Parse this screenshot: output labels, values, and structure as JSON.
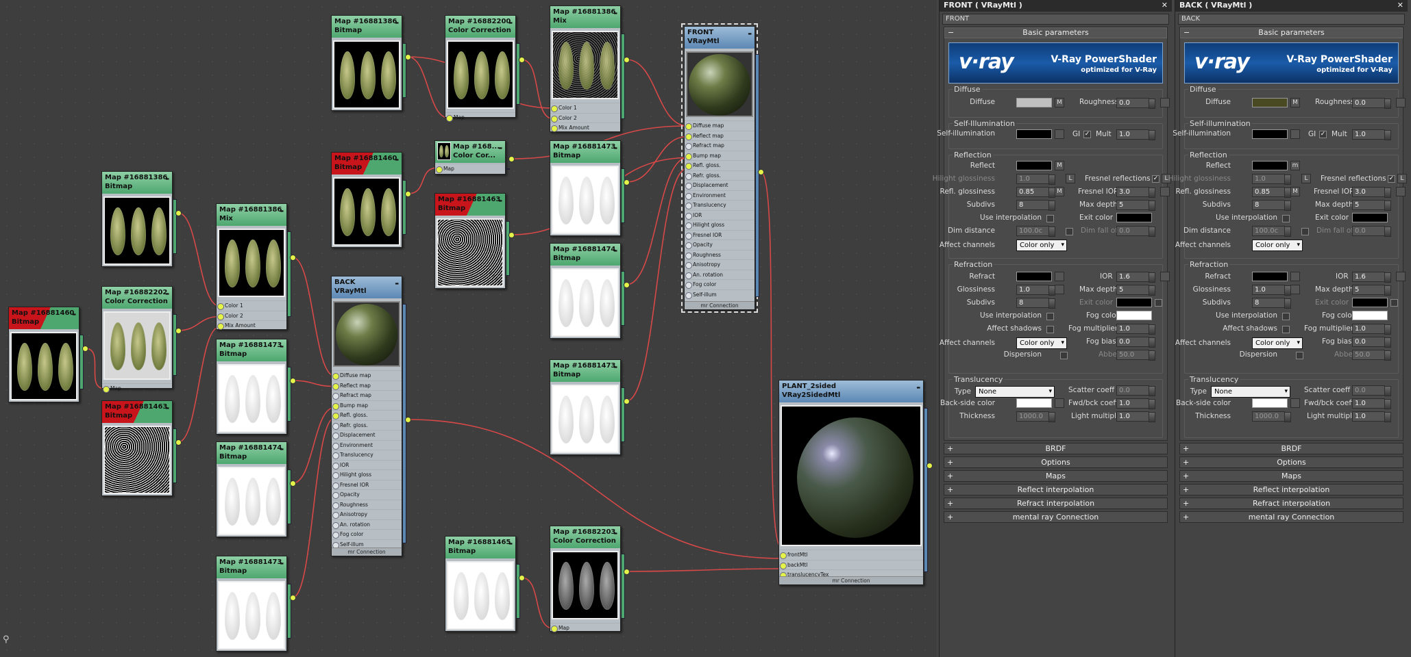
{
  "nodes": {
    "n1": {
      "id": "Map #16881460",
      "type": "Bitmap"
    },
    "n2": {
      "id": "Map #16881386",
      "type": "Bitmap"
    },
    "n3": {
      "id": "Map #16882202",
      "type": "Color Correction",
      "slots": [
        "Map"
      ]
    },
    "n4": {
      "id": "Map #16881463",
      "type": "Bitmap"
    },
    "n5": {
      "id": "Map #16881386",
      "type": "Mix",
      "slots": [
        "Color 1",
        "Color 2",
        "Mix Amount"
      ]
    },
    "n6": {
      "id": "Map #16881473",
      "type": "Bitmap"
    },
    "n7": {
      "id": "Map #16881474",
      "type": "Bitmap"
    },
    "n8": {
      "id": "Map #16881473",
      "type": "Bitmap"
    },
    "n9": {
      "id": "Map #16881386",
      "type": "Bitmap"
    },
    "n10": {
      "id": "Map #16881460",
      "type": "Bitmap"
    },
    "n11": {
      "id": "BACK",
      "type": "VRayMtl"
    },
    "n12": {
      "id": "Map #16882200",
      "type": "Color Correction",
      "slots": [
        "Map"
      ]
    },
    "n13": {
      "id": "Map #168...",
      "type": "Color Cor...",
      "slots": [
        "Map"
      ]
    },
    "n14": {
      "id": "Map #16881463",
      "type": "Bitmap"
    },
    "n15": {
      "id": "Map #16881465",
      "type": "Bitmap"
    },
    "n16": {
      "id": "Map #16881386",
      "type": "Mix",
      "slots": [
        "Color 1",
        "Color 2",
        "Mix Amount"
      ]
    },
    "n17": {
      "id": "Map #16881473",
      "type": "Bitmap"
    },
    "n18": {
      "id": "Map #16881474",
      "type": "Bitmap"
    },
    "n19": {
      "id": "Map #16881473",
      "type": "Bitmap"
    },
    "n20": {
      "id": "Map #16882203",
      "type": "Color Correction",
      "slots": [
        "Map"
      ]
    },
    "n21": {
      "id": "FRONT",
      "type": "VRayMtl"
    },
    "n22": {
      "id": "PLANT_2sided",
      "type": "VRay2SidedMtl",
      "slots": [
        "frontMtl",
        "backMtl",
        "translucencyTex"
      ]
    }
  },
  "vray_slots": [
    "Diffuse map",
    "Reflect map",
    "Refract map",
    "Bump map",
    "Refl. gloss.",
    "Refr. gloss.",
    "Displacement",
    "Environment",
    "Translucency",
    "IOR",
    "Hilight gloss",
    "Fresnel IOR",
    "Opacity",
    "Roughness",
    "Anisotropy",
    "An. rotation",
    "Fog color",
    "Self-illum"
  ],
  "mr_connection": "mr Connection",
  "mr_connection2": "mr Connection",
  "panels": [
    {
      "title": "FRONT  ( VRayMtl )",
      "name": "FRONT",
      "diffuse_color": "#c0c0c0",
      "basic": "Basic parameters",
      "logo_brand": "v·ray",
      "logo_title": "V-Ray PowerShader",
      "logo_sub": "optimized for V-Ray",
      "diffuse_grp": "Diffuse",
      "diffuse": "Diffuse",
      "m": "M",
      "roughness": "Roughness",
      "roughness_val": "0.0",
      "selfillum_grp": "Self-Illumination",
      "selfillum": "Self-illumination",
      "gi": "GI",
      "mult": "Mult",
      "mult_val": "1.0",
      "refl_grp": "Reflection",
      "reflect": "Reflect",
      "reflect_m": "M",
      "hilight": "Hilight glossiness",
      "hilight_val": "1.0",
      "l": "L",
      "fresnel": "Fresnel reflections",
      "reflgloss": "Refl. glossiness",
      "reflgloss_val": "0.85",
      "fresnel_ior": "Fresnel IOR",
      "fresnel_ior_val": "3.0",
      "subdivs": "Subdivs",
      "subdivs_val": "8",
      "maxdepth": "Max depth",
      "maxdepth_val": "5",
      "useinterp": "Use interpolation",
      "exitcolor": "Exit color",
      "dimdist": "Dim distance",
      "dimdist_val": "100.0c",
      "dimfall": "Dim fall off",
      "dimfall_val": "0.0",
      "affect": "Affect channels",
      "affect_val": "Color only",
      "refr_grp": "Refraction",
      "refract": "Refract",
      "ior": "IOR",
      "ior_val": "1.6",
      "gloss": "Glossiness",
      "gloss_val": "1.0",
      "r_maxdepth": "Max depth",
      "r_maxdepth_val": "5",
      "r_subdivs": "Subdivs",
      "r_subdivs_val": "8",
      "r_exit": "Exit color",
      "r_useinterp": "Use interpolation",
      "fogcolor": "Fog color",
      "affectshadows": "Affect shadows",
      "fogmult": "Fog multiplier",
      "fogmult_val": "1.0",
      "r_affect": "Affect channels",
      "r_affect_val": "Color only",
      "fogbias": "Fog bias",
      "fogbias_val": "0.0",
      "dispersion": "Dispersion",
      "abbe": "Abbe",
      "abbe_val": "50.0",
      "trans_grp": "Translucency",
      "type": "Type",
      "type_val": "None",
      "scatter": "Scatter coeff",
      "scatter_val": "0.0",
      "backside": "Back-side color",
      "fwdbck": "Fwd/bck coeff",
      "fwdbck_val": "1.0",
      "thickness": "Thickness",
      "thickness_val": "1000.0",
      "lightmult": "Light multiplier",
      "lightmult_val": "1.0",
      "rollouts": [
        "BRDF",
        "Options",
        "Maps",
        "Reflect interpolation",
        "Refract interpolation",
        "mental ray Connection"
      ]
    },
    {
      "title": "BACK  ( VRayMtl )",
      "name": "BACK",
      "diffuse_color": "#4a4a22",
      "basic": "Basic parameters",
      "logo_brand": "v·ray",
      "logo_title": "V-Ray PowerShader",
      "logo_sub": "optimized for V-Ray",
      "diffuse_grp": "Diffuse",
      "diffuse": "Diffuse",
      "m": "M",
      "roughness": "Roughness",
      "roughness_val": "0.0",
      "selfillum_grp": "Self-illumination",
      "selfillum": "Self-illumination",
      "gi": "GI",
      "mult": "Mult",
      "mult_val": "1.0",
      "refl_grp": "Reflection",
      "reflect": "Reflect",
      "reflect_m": "m",
      "hilight": "Hilight glossiness",
      "hilight_val": "1.0",
      "l": "L",
      "fresnel": "Fresnel reflections",
      "reflgloss": "Refl. glossiness",
      "reflgloss_val": "0.85",
      "fresnel_ior": "Fresnel IOR",
      "fresnel_ior_val": "3.0",
      "subdivs": "Subdivs",
      "subdivs_val": "8",
      "maxdepth": "Max depth",
      "maxdepth_val": "5",
      "useinterp": "Use interpolation",
      "exitcolor": "Exit color",
      "dimdist": "Dim distance",
      "dimdist_val": "100.0c",
      "dimfall": "Dim fall off",
      "dimfall_val": "0.0",
      "affect": "Affect channels",
      "affect_val": "Color only",
      "refr_grp": "Refraction",
      "refract": "Refract",
      "ior": "IOR",
      "ior_val": "1.6",
      "gloss": "Glossiness",
      "gloss_val": "1.0",
      "r_maxdepth": "Max depth",
      "r_maxdepth_val": "5",
      "r_subdivs": "Subdivs",
      "r_subdivs_val": "8",
      "r_exit": "Exit color",
      "r_useinterp": "Use interpolation",
      "fogcolor": "Fog color",
      "affectshadows": "Affect shadows",
      "fogmult": "Fog multiplier",
      "fogmult_val": "1.0",
      "r_affect": "Affect channels",
      "r_affect_val": "Color only",
      "fogbias": "Fog bias",
      "fogbias_val": "0.0",
      "dispersion": "Dispersion",
      "abbe": "Abbe",
      "abbe_val": "50.0",
      "trans_grp": "Translucency",
      "type": "Type",
      "type_val": "None",
      "scatter": "Scatter coeff",
      "scatter_val": "0.0",
      "backside": "Back-side color",
      "fwdbck": "Fwd/bck coeff",
      "fwdbck_val": "1.0",
      "thickness": "Thickness",
      "thickness_val": "1000.0",
      "lightmult": "Light multiplier",
      "lightmult_val": "1.0",
      "rollouts": [
        "BRDF",
        "Options",
        "Maps",
        "Reflect interpolation",
        "Refract interpolation",
        "mental ray Connection"
      ]
    }
  ],
  "status": {
    "icon": "binoculars-icon"
  }
}
